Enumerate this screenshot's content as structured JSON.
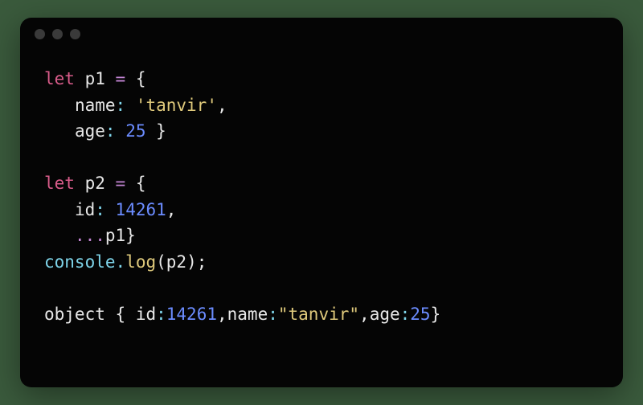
{
  "titlebar": {
    "dot1": "",
    "dot2": "",
    "dot3": ""
  },
  "code": {
    "l1_let": "let",
    "l1_var": " p1 ",
    "l1_eq": "=",
    "l1_sp": " ",
    "l1_brace": "{",
    "l2_indent": "   ",
    "l2_prop": "name",
    "l2_colon": ":",
    "l2_sp": " ",
    "l2_str": "'tanvir'",
    "l2_comma": ",",
    "l3_indent": "   ",
    "l3_prop": "age",
    "l3_colon": ":",
    "l3_sp": " ",
    "l3_num": "25",
    "l3_sp2": " ",
    "l3_brace": "}",
    "l5_let": "let",
    "l5_var": " p2 ",
    "l5_eq": "=",
    "l5_sp": " ",
    "l5_brace": "{",
    "l6_indent": "   ",
    "l6_prop": "id",
    "l6_colon": ":",
    "l6_sp": " ",
    "l6_num": "14261",
    "l6_comma": ",",
    "l7_indent": "   ",
    "l7_spread": "...",
    "l7_var": "p1",
    "l7_brace": "}",
    "l8_obj": "console",
    "l8_dot": ".",
    "l8_method": "log",
    "l8_lparen": "(",
    "l8_arg": "p2",
    "l8_rparen": ")",
    "l8_semi": ";",
    "l10_obj": "object ",
    "l10_lbrace": "{ ",
    "l10_p1": "id",
    "l10_c1": ":",
    "l10_n1": "14261",
    "l10_cm1": ",",
    "l10_p2": "name",
    "l10_c2": ":",
    "l10_s2": "\"tanvir\"",
    "l10_cm2": ",",
    "l10_p3": "age",
    "l10_c3": ":",
    "l10_n3": "25",
    "l10_rbrace": "}"
  }
}
